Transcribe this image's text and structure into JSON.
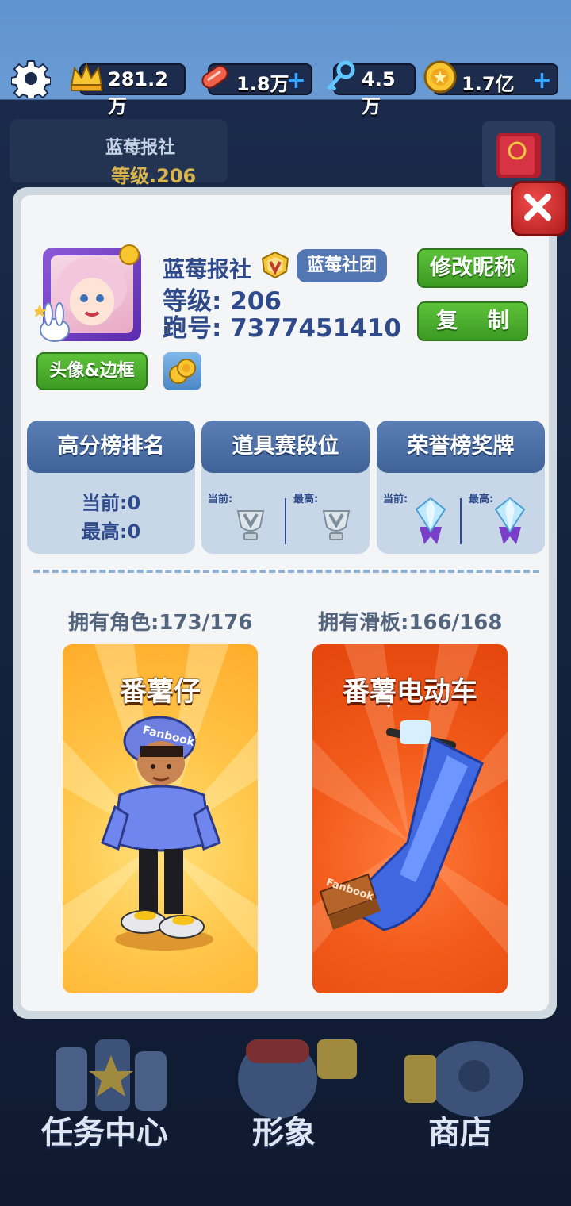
{
  "topbar": {
    "settings_icon": "gear-icon",
    "crown": {
      "icon": "crown-icon",
      "value": "281.2万"
    },
    "board": {
      "icon": "hoverboard-icon",
      "value": "1.8万"
    },
    "key": {
      "icon": "key-icon",
      "value": "4.5万"
    },
    "coin": {
      "icon": "coin-icon",
      "value": "1.7亿"
    },
    "plus": "+"
  },
  "background": {
    "player_name": "蓝莓报社",
    "player_level": "等级.206",
    "bottom_nav": [
      "任务中心",
      "形象",
      "商店"
    ]
  },
  "profile": {
    "nickname": "蓝莓报社",
    "club": "蓝莓社团",
    "level": "等级: 206",
    "run_id": "跑号: 7377451410",
    "rename_button": "修改昵称",
    "copy_button": "复    制",
    "avatar_frame_button": "头像&边框"
  },
  "stats": [
    {
      "title": "高分榜排名",
      "current": "当前:0",
      "best": "最高:0"
    },
    {
      "title": "道具赛段位",
      "current_label": "当前:",
      "best_label": "最高:"
    },
    {
      "title": "荣誉榜奖牌",
      "current_label": "当前:",
      "best_label": "最高:"
    }
  ],
  "collection": {
    "characters_owned": "拥有角色:173/176",
    "boards_owned": "拥有滑板:166/168",
    "character_name": "番薯仔",
    "board_name": "番薯电动车",
    "character_cap_text": "Fanbook",
    "board_label_text": "Fanbook"
  },
  "colors": {
    "accent_green": "#4caf2a",
    "navy_text": "#2e4a8a",
    "close_red": "#d42b2b",
    "card_yellow": "#ffb12a",
    "card_orange": "#f24d12"
  }
}
